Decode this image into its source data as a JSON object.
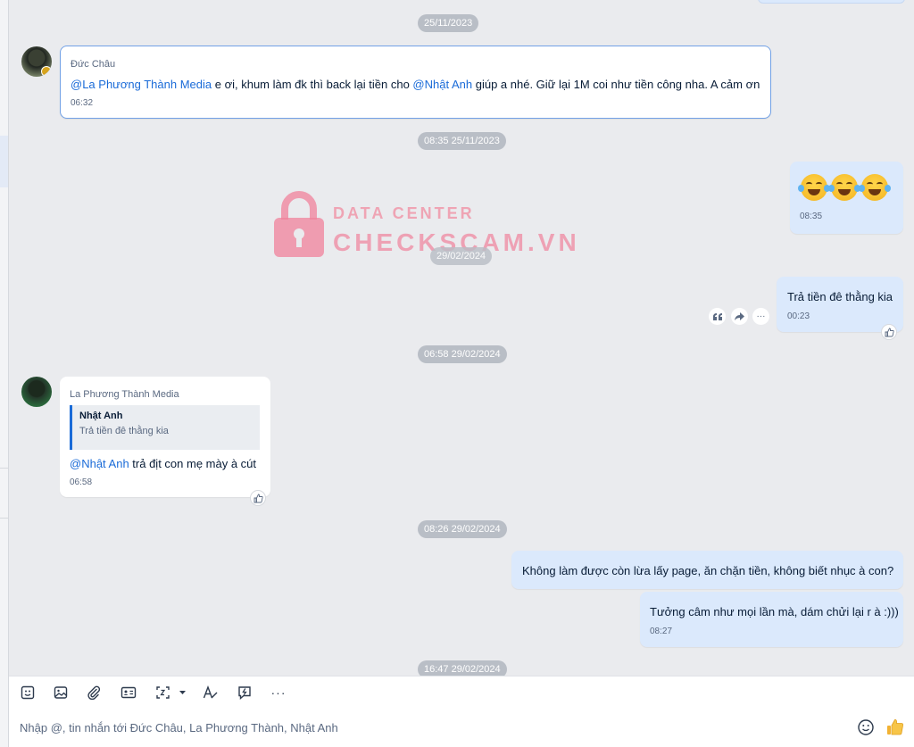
{
  "dates": {
    "d1": "25/11/2023",
    "d2": "08:35 25/11/2023",
    "d3": "29/02/2024",
    "d4": "06:58 29/02/2024",
    "d5": "08:26 29/02/2024",
    "d6": "16:47 29/02/2024"
  },
  "watermark": {
    "line1": "DATA CENTER",
    "line2": "CHECKSCAM.VN"
  },
  "messages": {
    "m1": {
      "sender": "Đức Châu",
      "mention1": "@La Phương Thành Media",
      "text1": " e ơi, khum làm đk thì back lại tiền cho ",
      "mention2": "@Nhật Anh",
      "text2": " giúp a nhé. Giữ lại 1M coi như tiền công nha. A cảm ơn",
      "time": "06:32"
    },
    "m2": {
      "time": "08:35"
    },
    "m3": {
      "text": "Trả tiền đê thằng kia",
      "time": "00:23"
    },
    "m4": {
      "sender": "La Phương Thành Media",
      "quote_name": "Nhật Anh",
      "quote_text": "Trả tiền đê thằng kia",
      "mention": "@Nhật Anh",
      "text": " trả địt con mẹ mày à cút",
      "time": "06:58"
    },
    "m5": {
      "text": "Không làm được còn lừa lấy page, ăn chặn tiền, không biết nhục à con?"
    },
    "m6": {
      "text": "Tưởng câm như mọi lần mà, dám chửi lại r à :)))",
      "time": "08:27"
    }
  },
  "composer": {
    "placeholder": "Nhập @, tin nhắn tới Đức Châu, La Phương Thành, Nhật Anh",
    "icons": [
      "sticker-icon",
      "image-icon",
      "attach-icon",
      "contact-card-icon",
      "screenshot-icon",
      "format-text-icon",
      "quick-message-icon",
      "more-icon"
    ]
  },
  "colors": {
    "accent": "#1a6bd8",
    "outgoing_bubble": "#dbe9fc",
    "background": "#eaebee"
  }
}
